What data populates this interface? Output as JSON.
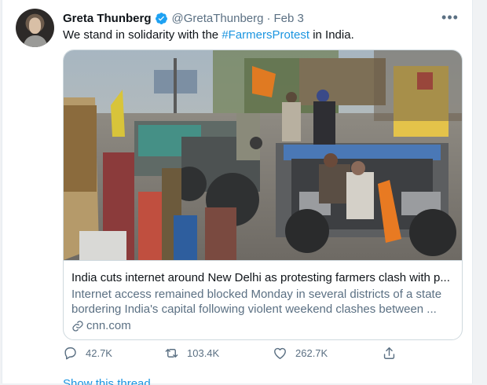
{
  "tweet": {
    "name": "Greta Thunberg",
    "handle": "@GretaThunberg",
    "separator": "·",
    "date": "Feb 3",
    "more_label": "•••",
    "text_before": "We stand in solidarity with the ",
    "hashtag": "#FarmersProtest",
    "text_after": " in India.",
    "icons": [
      "verified-badge-icon",
      "more-icon",
      "link-icon",
      "reply-icon",
      "retweet-icon",
      "like-icon",
      "share-icon"
    ]
  },
  "card": {
    "title": "India cuts internet around New Delhi as protesting farmers clash with p...",
    "description": "Internet access remained blocked Monday in several districts of a state bordering India's capital following violent weekend clashes between ...",
    "domain": "cnn.com"
  },
  "actions": {
    "replies": "42.7K",
    "retweets": "103.4K",
    "likes": "262.7K"
  },
  "peek": {
    "text": "Show this thread"
  },
  "colors": {
    "link_blue": "#1b95e0",
    "secondary_text": "#5b7083",
    "verified_blue": "#1da1f2",
    "border": "#cfd9de"
  }
}
